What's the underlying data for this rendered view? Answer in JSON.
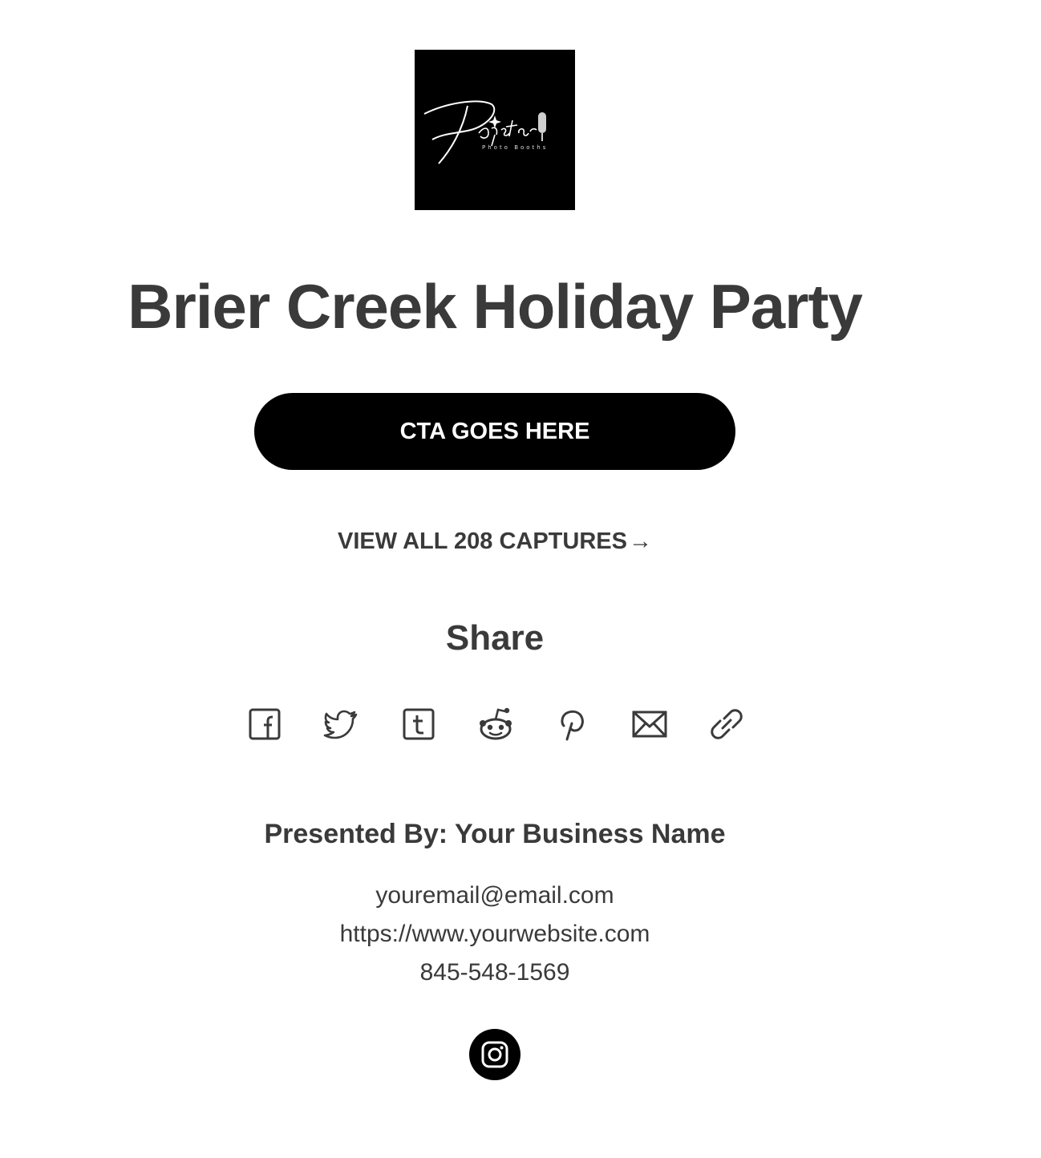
{
  "brand": {
    "logo_icon": "popstar-photo-booths-logo",
    "logo_text": "Popstar",
    "logo_subtext": "Photo Booths"
  },
  "event": {
    "title": "Brier Creek Holiday Party"
  },
  "cta": {
    "label": "CTA GOES HERE"
  },
  "gallery": {
    "view_all_label": "VIEW ALL 208 CAPTURES",
    "arrow": "→"
  },
  "share": {
    "heading": "Share",
    "icons": [
      "facebook-icon",
      "twitter-icon",
      "tumblr-icon",
      "reddit-icon",
      "pinterest-icon",
      "email-icon",
      "link-icon"
    ]
  },
  "footer": {
    "presented_by": "Presented By: Your Business Name",
    "email": "youremail@email.com",
    "website": "https://www.yourwebsite.com",
    "phone": "845-548-1569",
    "social_icon": "instagram-icon"
  },
  "colors": {
    "text": "#3a3a3a",
    "button_bg": "#000000",
    "button_text": "#ffffff",
    "background": "#ffffff"
  }
}
